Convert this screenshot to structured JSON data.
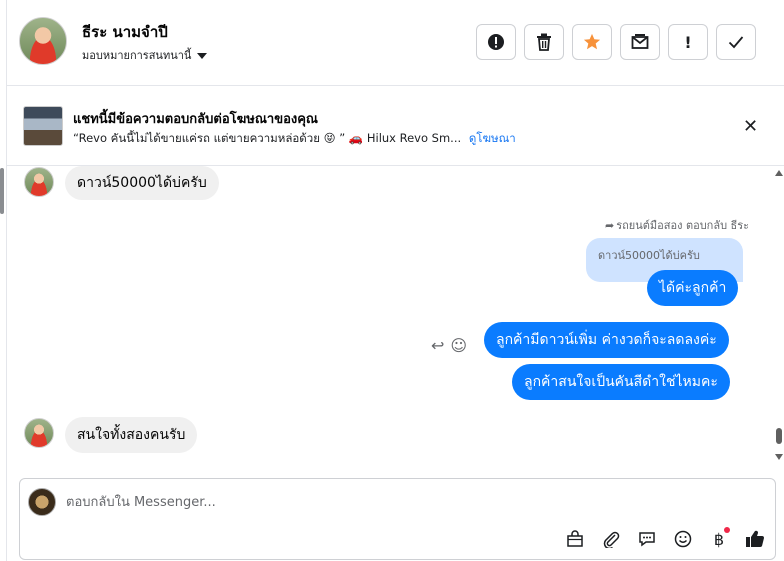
{
  "header": {
    "contact_name": "ธีระ นามจำปี",
    "assign_label": "มอบหมายการสนทนานี้",
    "actions": [
      {
        "name": "report",
        "symbol": "❗"
      },
      {
        "name": "delete",
        "symbol": "🗑"
      },
      {
        "name": "star",
        "symbol": "★"
      },
      {
        "name": "mark-unread",
        "symbol": "✉"
      },
      {
        "name": "follow-up",
        "symbol": "!"
      },
      {
        "name": "done",
        "symbol": "✓"
      }
    ]
  },
  "banner": {
    "title": "แชทนี้มีข้อความตอบกลับต่อโฆษณาของคุณ",
    "subtitle": "“Revo คันนี้ไม่ได้ขายแค่รถ แต่ขายความหล่อด้วย 😝 ” 🚗 Hilux Revo Sm...",
    "link": "ดูโฆษณา",
    "close": "✕"
  },
  "messages": {
    "m1": "ดาวน์50000ได้บ่ครับ",
    "reply_note": "รถยนต์มือสอง ตอบกลับ ธีระ",
    "quoted": "ดาวน์50000ได้บ่ครับ",
    "m2": "ได้ค่ะลูกค้า",
    "m3": "ลูกค้ามีดาวน์เพิ่ม ค่างวดก็จะลดลงค่ะ",
    "m4": "ลูกค้าสนใจเป็นคันสีดำใช่ไหมคะ",
    "m5": "สนใจทั้งสองคนรับ"
  },
  "composer": {
    "placeholder": "ตอบกลับใน Messenger...",
    "tools": [
      {
        "name": "shop-bag-icon",
        "symbol": "🛍"
      },
      {
        "name": "attachment-icon",
        "symbol": "📎"
      },
      {
        "name": "saved-reply-icon",
        "symbol": "💬"
      },
      {
        "name": "emoji-icon",
        "symbol": "☺"
      },
      {
        "name": "baht-icon",
        "symbol": "฿"
      },
      {
        "name": "like-icon",
        "symbol": "👍"
      }
    ]
  },
  "colors": {
    "outgoing_bubble": "#0a7cff",
    "incoming_bubble": "#f0f0f0",
    "quoted_bubble": "#cfe3ff",
    "link": "#1877f2"
  }
}
